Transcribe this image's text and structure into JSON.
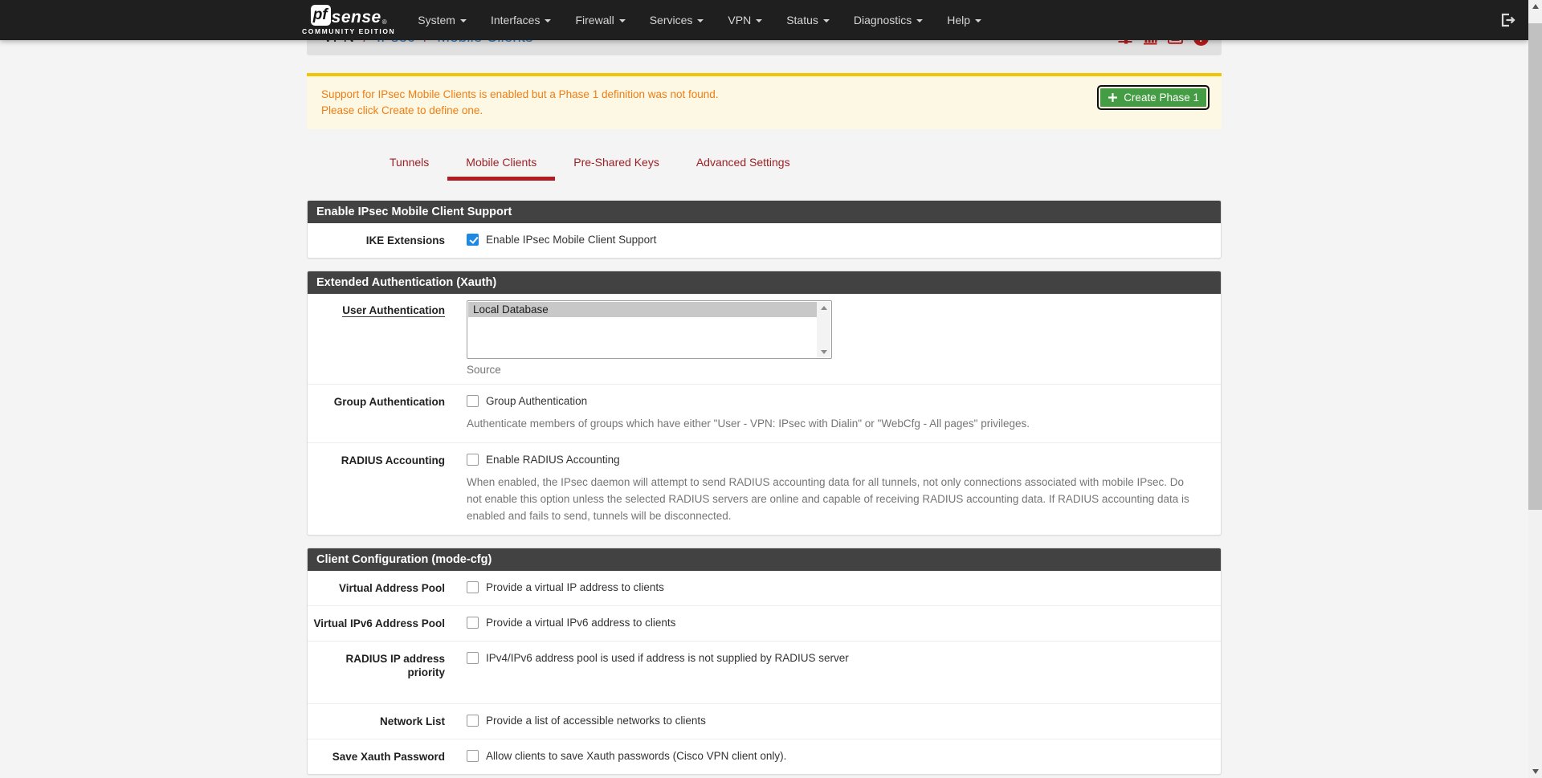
{
  "navbar": {
    "logo": {
      "pf": "pf",
      "sense": "sense",
      "registered": "®",
      "edition": "COMMUNITY EDITION"
    },
    "menus": [
      {
        "label": "System"
      },
      {
        "label": "Interfaces"
      },
      {
        "label": "Firewall"
      },
      {
        "label": "Services"
      },
      {
        "label": "VPN"
      },
      {
        "label": "Status"
      },
      {
        "label": "Diagnostics"
      },
      {
        "label": "Help"
      }
    ],
    "icons": {
      "right": "sign-out-icon"
    }
  },
  "breadcrumb": {
    "section": "VPN",
    "sep1": "/",
    "page": "IPsec",
    "sep2": "/",
    "subpage": "Mobile Clients",
    "icons": [
      "sliders-icon",
      "chart-bar-icon",
      "log-icon",
      "help-icon"
    ]
  },
  "alert": {
    "line1": "Support for IPsec Mobile Clients is enabled but a Phase 1 definition was not found.",
    "line2": "Please click Create to define one.",
    "create_button": "Create Phase 1"
  },
  "tabs": [
    {
      "label": "Tunnels",
      "active": false
    },
    {
      "label": "Mobile Clients",
      "active": true
    },
    {
      "label": "Pre-Shared Keys",
      "active": false
    },
    {
      "label": "Advanced Settings",
      "active": false
    }
  ],
  "sections": [
    {
      "title": "Enable IPsec Mobile Client Support",
      "rows": [
        {
          "label": "IKE Extensions",
          "checkbox_label": "Enable IPsec Mobile Client Support",
          "checked": true
        }
      ]
    },
    {
      "title": "Extended Authentication (Xauth)",
      "rows": [
        {
          "label": "User Authentication",
          "options": [
            "Local Database"
          ],
          "selected": "Local Database",
          "help": "Source"
        },
        {
          "label": "Group Authentication",
          "checkbox_label": "Group Authentication",
          "checked": false,
          "help": "Authenticate members of groups which have either \"User - VPN: IPsec with Dialin\" or \"WebCfg - All pages\" privileges."
        },
        {
          "label": "RADIUS Accounting",
          "checkbox_label": "Enable RADIUS Accounting",
          "checked": false,
          "help": "When enabled, the IPsec daemon will attempt to send RADIUS accounting data for all tunnels, not only connections associated with mobile IPsec. Do not enable this option unless the selected RADIUS servers are online and capable of receiving RADIUS accounting data. If RADIUS accounting data is enabled and fails to send, tunnels will be disconnected."
        }
      ]
    },
    {
      "title": "Client Configuration (mode-cfg)",
      "rows": [
        {
          "label": "Virtual Address Pool",
          "checkbox_label": "Provide a virtual IP address to clients",
          "checked": false
        },
        {
          "label": "Virtual IPv6 Address Pool",
          "checkbox_label": "Provide a virtual IPv6 address to clients",
          "checked": false
        },
        {
          "label": "RADIUS IP address priority",
          "checkbox_label": "IPv4/IPv6 address pool is used if address is not supplied by RADIUS server",
          "checked": false
        },
        {
          "label": "Network List",
          "checkbox_label": "Provide a list of accessible networks to clients",
          "checked": false
        },
        {
          "label": "Save Xauth Password",
          "checkbox_label": "Allow clients to save Xauth passwords (Cisco VPN client only).",
          "checked": false
        }
      ]
    }
  ],
  "colors": {
    "navbar_bg": "#1f1f1f",
    "accent_red": "#b71c1c",
    "link_blue": "#337ab7",
    "warning_bg": "#fcf8e3",
    "warning_border": "#f2c500",
    "warning_text": "#ef7d14",
    "button_green": "#449d44",
    "checkbox_blue": "#1e88e5",
    "tab_text": "#9c2025",
    "tab_underline": "#b01c21",
    "section_header_bg": "#424242"
  }
}
